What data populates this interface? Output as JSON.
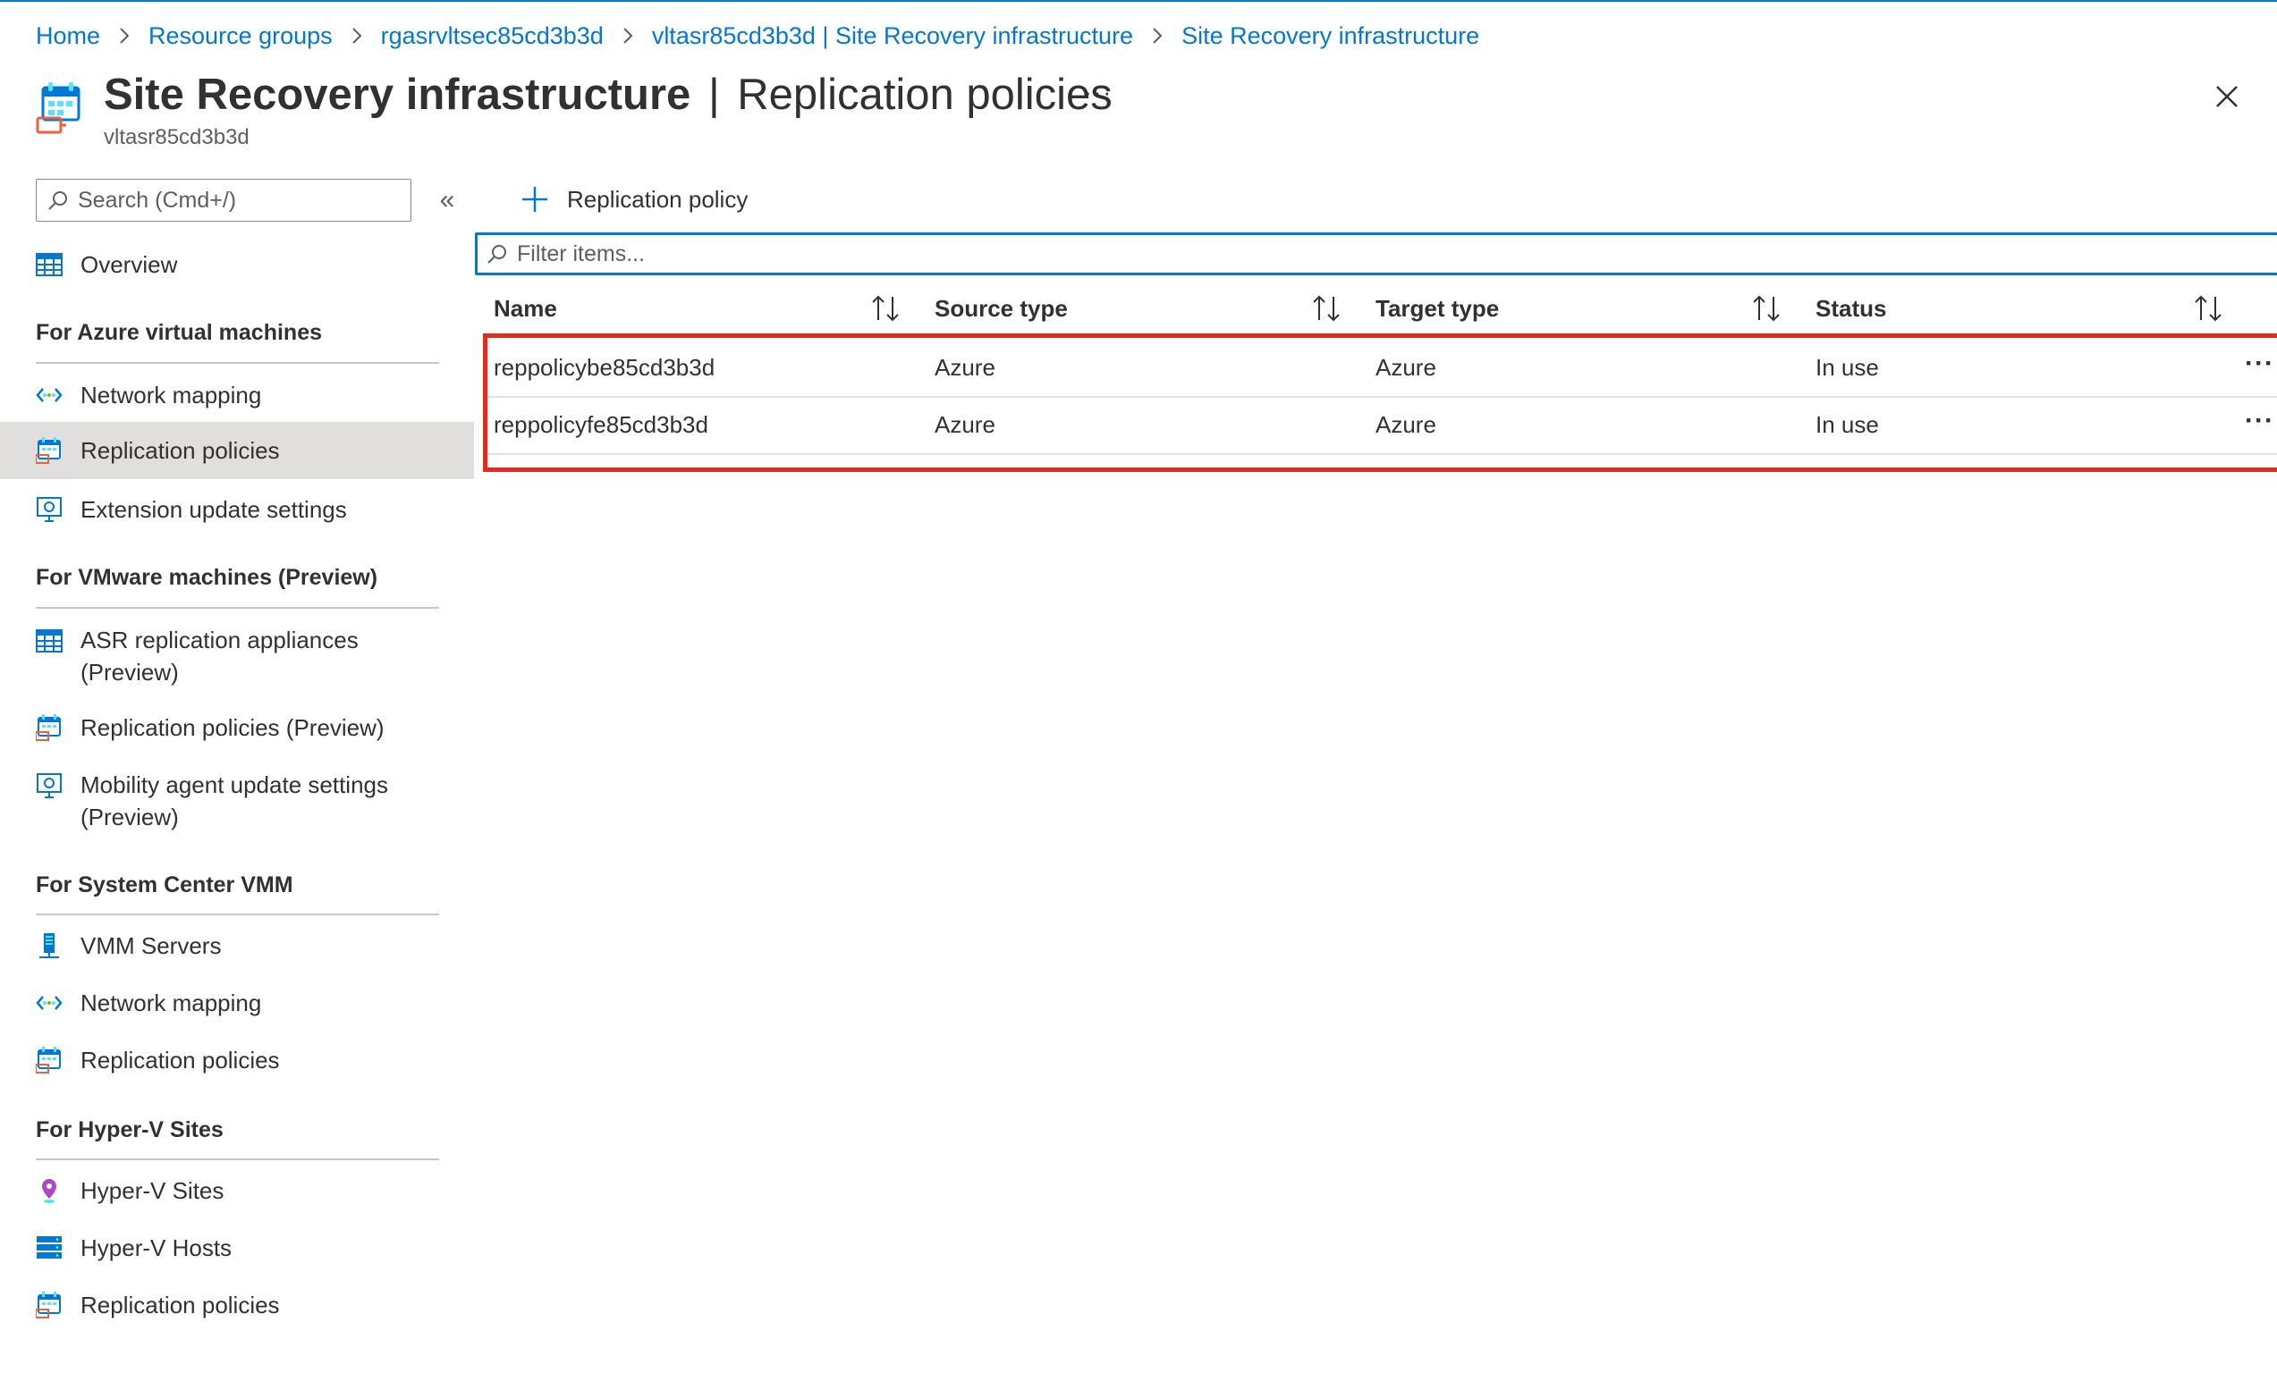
{
  "breadcrumb": [
    "Home",
    "Resource groups",
    "rgasrvltsec85cd3b3d",
    "vltasr85cd3b3d | Site Recovery infrastructure",
    "Site Recovery infrastructure"
  ],
  "header": {
    "title_bold": "Site Recovery infrastructure",
    "title_separator": "|",
    "title_rest": "Replication policies",
    "more_label": "···",
    "subtitle": "vltasr85cd3b3d"
  },
  "sidebar": {
    "search_placeholder": "Search (Cmd+/)",
    "collapse_label": "«",
    "overview": "Overview",
    "sections": [
      {
        "title": "For Azure virtual machines",
        "items": [
          "Network mapping",
          "Replication policies",
          "Extension update settings"
        ]
      },
      {
        "title": "For VMware machines (Preview)",
        "items": [
          "ASR replication appliances",
          "(Preview)",
          "Replication policies (Preview)",
          "Mobility agent update settings",
          "(Preview)"
        ]
      },
      {
        "title": "For System Center VMM",
        "items": [
          "VMM Servers",
          "Network mapping",
          "Replication policies"
        ]
      },
      {
        "title": "For Hyper-V Sites",
        "items": [
          "Hyper-V Sites",
          "Hyper-V Hosts",
          "Replication policies"
        ]
      }
    ],
    "selected_item": "Replication policies"
  },
  "toolbar": {
    "add_label": "Replication policy"
  },
  "filter": {
    "placeholder": "Filter items..."
  },
  "table": {
    "columns": [
      "Name",
      "Source type",
      "Target type",
      "Status"
    ],
    "rows": [
      {
        "name": "reppolicybe85cd3b3d",
        "source": "Azure",
        "target": "Azure",
        "status": "In use"
      },
      {
        "name": "reppolicyfe85cd3b3d",
        "source": "Azure",
        "target": "Azure",
        "status": "In use"
      }
    ],
    "row_more_label": "···"
  },
  "colors": {
    "accent": "#0078d4",
    "highlight": "#e8291c",
    "selected_bg": "#e1dfdd"
  },
  "icons": {
    "header": "site-recovery-icon",
    "close": "close-icon",
    "search": "search-icon",
    "add": "plus-icon",
    "sort": "sort-icon"
  }
}
